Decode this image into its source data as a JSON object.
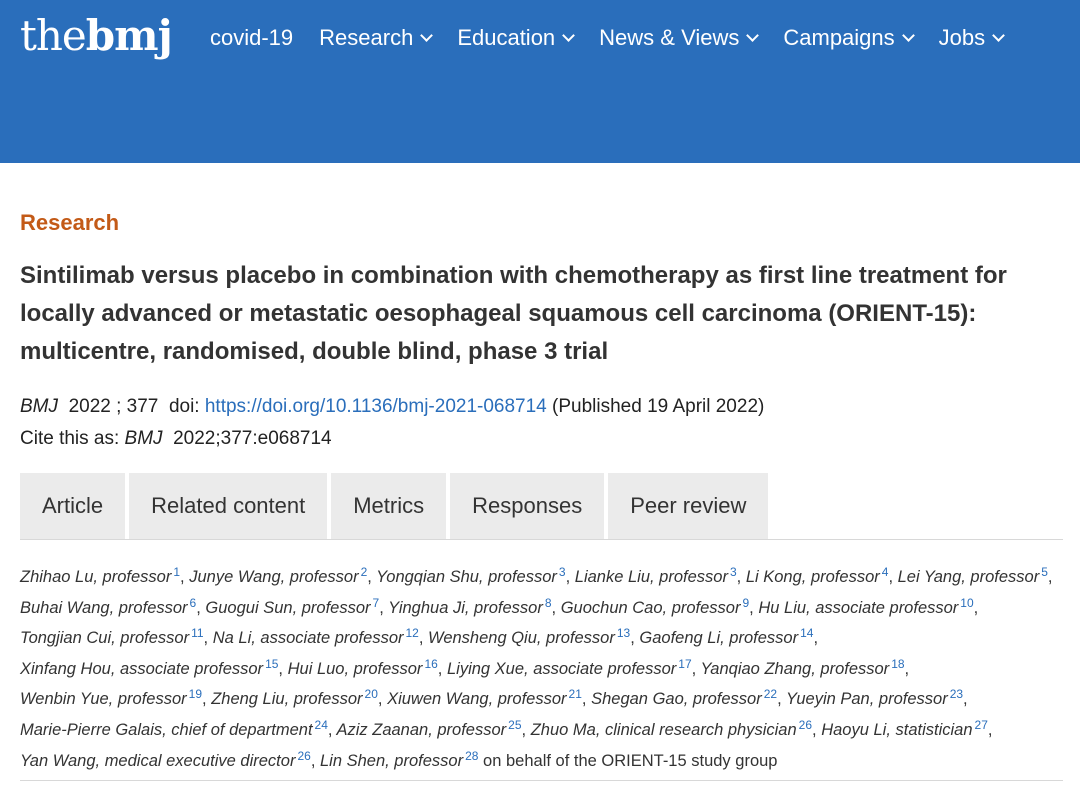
{
  "header": {
    "logo_the": "the",
    "logo_bmj": "bmj",
    "nav": [
      {
        "label": "covid-19",
        "dropdown": false
      },
      {
        "label": "Research",
        "dropdown": true
      },
      {
        "label": "Education",
        "dropdown": true
      },
      {
        "label": "News & Views",
        "dropdown": true
      },
      {
        "label": "Campaigns",
        "dropdown": true
      },
      {
        "label": "Jobs",
        "dropdown": true
      }
    ],
    "bg_color": "#2a6ebb"
  },
  "article": {
    "section": "Research",
    "title": "Sintilimab versus placebo in combination with chemotherapy as first line treatment for locally advanced or metastatic oesophageal squamous cell carcinoma (ORIENT-15): multicentre, randomised, double blind, phase 3 trial",
    "journal": "BMJ",
    "year_vol": "2022 ; 377",
    "doi_label": "doi:",
    "doi_url": "https://doi.org/10.1136/bmj-2021-068714",
    "published": "(Published 19 April 2022)",
    "cite_prefix": "Cite this as:",
    "cite_journal": "BMJ",
    "cite_ref": "2022;377:e068714"
  },
  "tabs": [
    "Article",
    "Related content",
    "Metrics",
    "Responses",
    "Peer review"
  ],
  "authors": [
    {
      "name": "Zhihao Lu, professor",
      "aff": "1"
    },
    {
      "name": "Junye Wang, professor",
      "aff": "2"
    },
    {
      "name": "Yongqian Shu, professor",
      "aff": "3"
    },
    {
      "name": "Lianke Liu, professor",
      "aff": "3"
    },
    {
      "name": "Li Kong, professor",
      "aff": "4"
    },
    {
      "name": "Lei Yang, professor",
      "aff": "5"
    },
    {
      "name": "Buhai Wang, professor",
      "aff": "6"
    },
    {
      "name": "Guogui Sun, professor",
      "aff": "7"
    },
    {
      "name": "Yinghua Ji, professor",
      "aff": "8"
    },
    {
      "name": "Guochun Cao, professor",
      "aff": "9"
    },
    {
      "name": "Hu Liu, associate professor",
      "aff": "10"
    },
    {
      "name": "Tongjian Cui, professor",
      "aff": "11"
    },
    {
      "name": "Na Li, associate professor",
      "aff": "12"
    },
    {
      "name": "Wensheng Qiu, professor",
      "aff": "13"
    },
    {
      "name": "Gaofeng Li, professor",
      "aff": "14"
    },
    {
      "name": "Xinfang Hou, associate professor",
      "aff": "15"
    },
    {
      "name": "Hui Luo, professor",
      "aff": "16"
    },
    {
      "name": "Liying Xue, associate professor",
      "aff": "17"
    },
    {
      "name": "Yanqiao Zhang, professor",
      "aff": "18"
    },
    {
      "name": "Wenbin Yue, professor",
      "aff": "19"
    },
    {
      "name": "Zheng Liu, professor",
      "aff": "20"
    },
    {
      "name": "Xiuwen Wang, professor",
      "aff": "21"
    },
    {
      "name": "Shegan Gao, professor",
      "aff": "22"
    },
    {
      "name": "Yueyin Pan, professor",
      "aff": "23"
    },
    {
      "name": "Marie-Pierre Galais, chief of department",
      "aff": "24"
    },
    {
      "name": "Aziz Zaanan, professor",
      "aff": "25"
    },
    {
      "name": "Zhuo Ma, clinical research physician",
      "aff": "26"
    },
    {
      "name": "Haoyu Li, statistician",
      "aff": "27"
    },
    {
      "name": "Yan Wang, medical executive director",
      "aff": "26"
    },
    {
      "name": "Lin Shen, professor",
      "aff": "28"
    }
  ],
  "authors_tail": "on behalf of the ORIENT-15 study group",
  "colors": {
    "section": "#c35a17",
    "link": "#2a6ebb",
    "tab_bg": "#ebebeb"
  }
}
